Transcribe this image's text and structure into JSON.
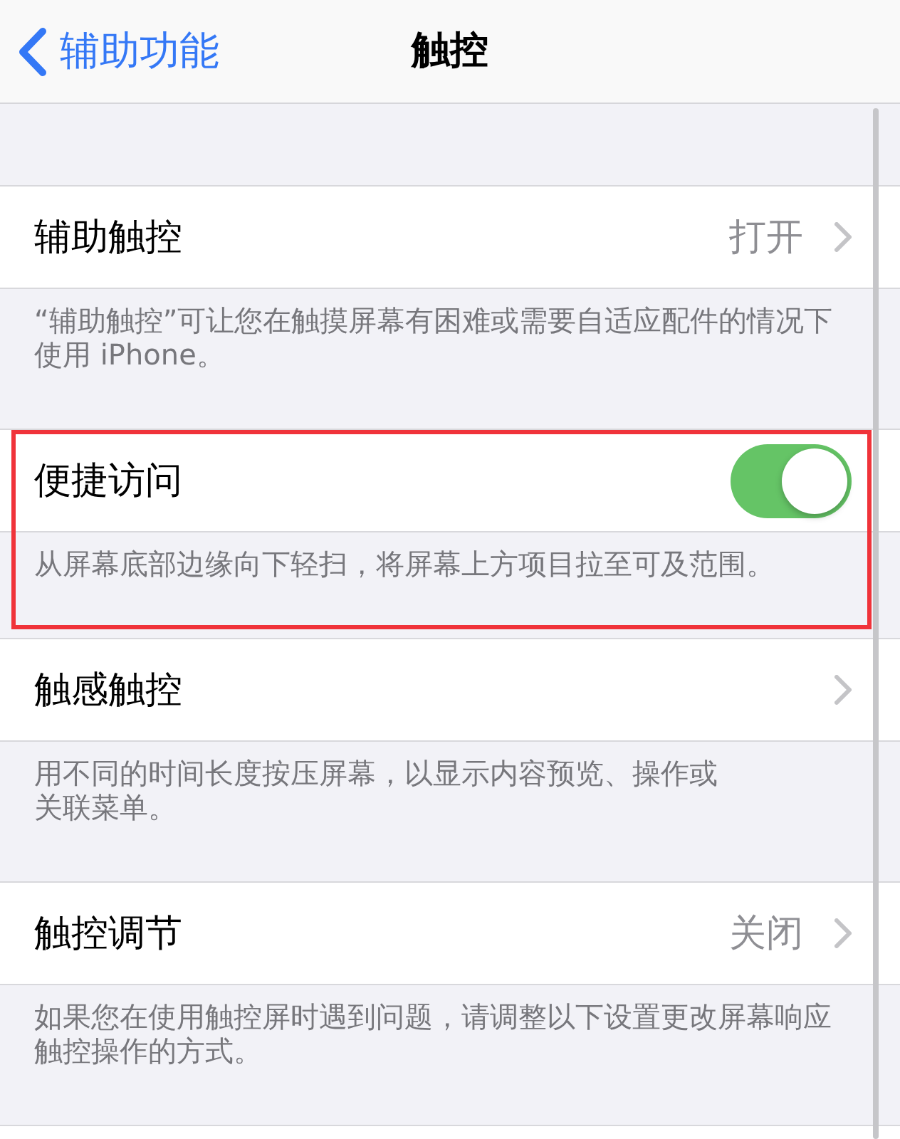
{
  "nav_bar": {
    "back_label": "辅助功能",
    "title": "触控"
  },
  "sections": [
    {
      "row": {
        "kind": "link",
        "label": "辅助触控",
        "value": "打开"
      },
      "footer_lines": [
        "“辅助触控”可让您在触摸屏幕有困难或需要自适应配件的情况下",
        "使用 iPhone。"
      ],
      "highlighted": false
    },
    {
      "row": {
        "kind": "toggle",
        "label": "便捷访问",
        "on": true
      },
      "footer_lines": [
        "从屏幕底部边缘向下轻扫，将屏幕上方项目拉至可及范围。"
      ],
      "highlighted": true
    },
    {
      "row": {
        "kind": "link",
        "label": "触感触控"
      },
      "footer_lines": [
        "用不同的时间长度按压屏幕，以显示内容预览、操作或",
        "关联菜单。"
      ],
      "highlighted": false
    },
    {
      "row": {
        "kind": "link",
        "label": "触控调节",
        "value": "关闭"
      },
      "footer_lines": [
        "如果您在使用触控屏时遇到问题，请调整以下设置更改屏幕响应",
        "触控操作的方式。"
      ],
      "highlighted": false
    }
  ]
}
